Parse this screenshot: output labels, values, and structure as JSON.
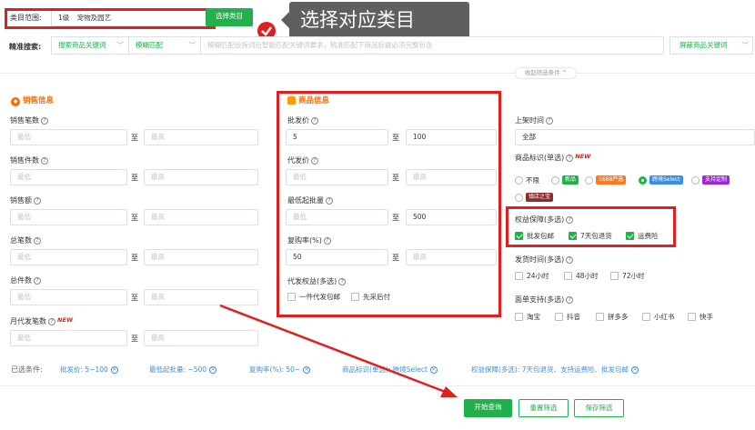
{
  "category": {
    "label": "类目范围:",
    "level": "1级",
    "value": "宠物及园艺",
    "button": "选择类目"
  },
  "annotation": {
    "text": "选择对应类目"
  },
  "search": {
    "label": "精准搜索:",
    "keyword_select": "搜索商品关键词",
    "match_select": "模糊匹配",
    "placeholder": "模糊匹配会拆词后智能匹配关键词要求，精准匹配下商品标题必须完整包含",
    "block_select": "屏蔽商品关键词"
  },
  "collapse": "收起筛选条件",
  "sales": {
    "title": "销售信息",
    "fields": [
      {
        "label": "销售笔数",
        "min": "最低",
        "max": "最高",
        "new": ""
      },
      {
        "label": "销售件数",
        "min": "最低",
        "max": "最高",
        "new": ""
      },
      {
        "label": "销售额",
        "min": "最低",
        "max": "最高",
        "new": ""
      },
      {
        "label": "总笔数",
        "min": "最低",
        "max": "最高",
        "new": ""
      },
      {
        "label": "总件数",
        "min": "最低",
        "max": "最高",
        "new": ""
      },
      {
        "label": "月代发笔数",
        "min": "最低",
        "max": "最高",
        "new": "NEW"
      }
    ],
    "to": "至"
  },
  "product": {
    "title": "商品信息",
    "wholesale_label": "批发价",
    "wholesale_min": "5",
    "wholesale_max": "100",
    "dropship_label": "代发价",
    "dropship_min": "最低",
    "dropship_max": "最高",
    "moq_label": "最低起批量",
    "moq_min": "最低",
    "moq_max": "500",
    "repurchase_label": "复购率(%)",
    "repurchase_min": "50",
    "repurchase_max": "最高",
    "benefit_label": "代发权益(多选)",
    "benefits": [
      "一件代发包邮",
      "先采后付"
    ]
  },
  "right": {
    "listing_label": "上架时间",
    "listing_value": "全部",
    "marks_label": "商品标识(单选)",
    "marks_new": "NEW",
    "marks": [
      {
        "text": "不限",
        "tag": false,
        "color": ""
      },
      {
        "text": "新品",
        "tag": true,
        "color": "#21b04b"
      },
      {
        "text": "1688严选",
        "tag": true,
        "color": "#ff7a1a"
      },
      {
        "text": "跨境Select",
        "tag": true,
        "color": "#3c8fe0"
      },
      {
        "text": "支持定制",
        "tag": true,
        "color": "#9b27d8"
      },
      {
        "text": "镇店之宝",
        "tag": true,
        "color": "#8b2e2e"
      }
    ],
    "guarantee_label": "权益保障(多选)",
    "guarantees": [
      "批发包邮",
      "7天包退货",
      "运费险"
    ],
    "ship_label": "发货时间(多选)",
    "ship_options": [
      "24小时",
      "48小时",
      "72小时"
    ],
    "platform_label": "面单支持(多选)",
    "platforms": [
      "淘宝",
      "抖音",
      "拼多多",
      "小红书",
      "快手"
    ]
  },
  "selected": {
    "label": "已选条件:",
    "chips": [
      "批发价: 5~100",
      "最低起批量: ~500",
      "复购率(%): 50~",
      "商品标识(单选): 跨境Select",
      "权益保障(多选): 7天包退货、支持运费险、批发包邮"
    ]
  },
  "actions": {
    "search": "开始查询",
    "reset": "重置筛选",
    "save": "保存筛选"
  },
  "colors": {
    "accent": "#21b04b",
    "highlight": "#e02020",
    "link": "#3c8fe0"
  }
}
